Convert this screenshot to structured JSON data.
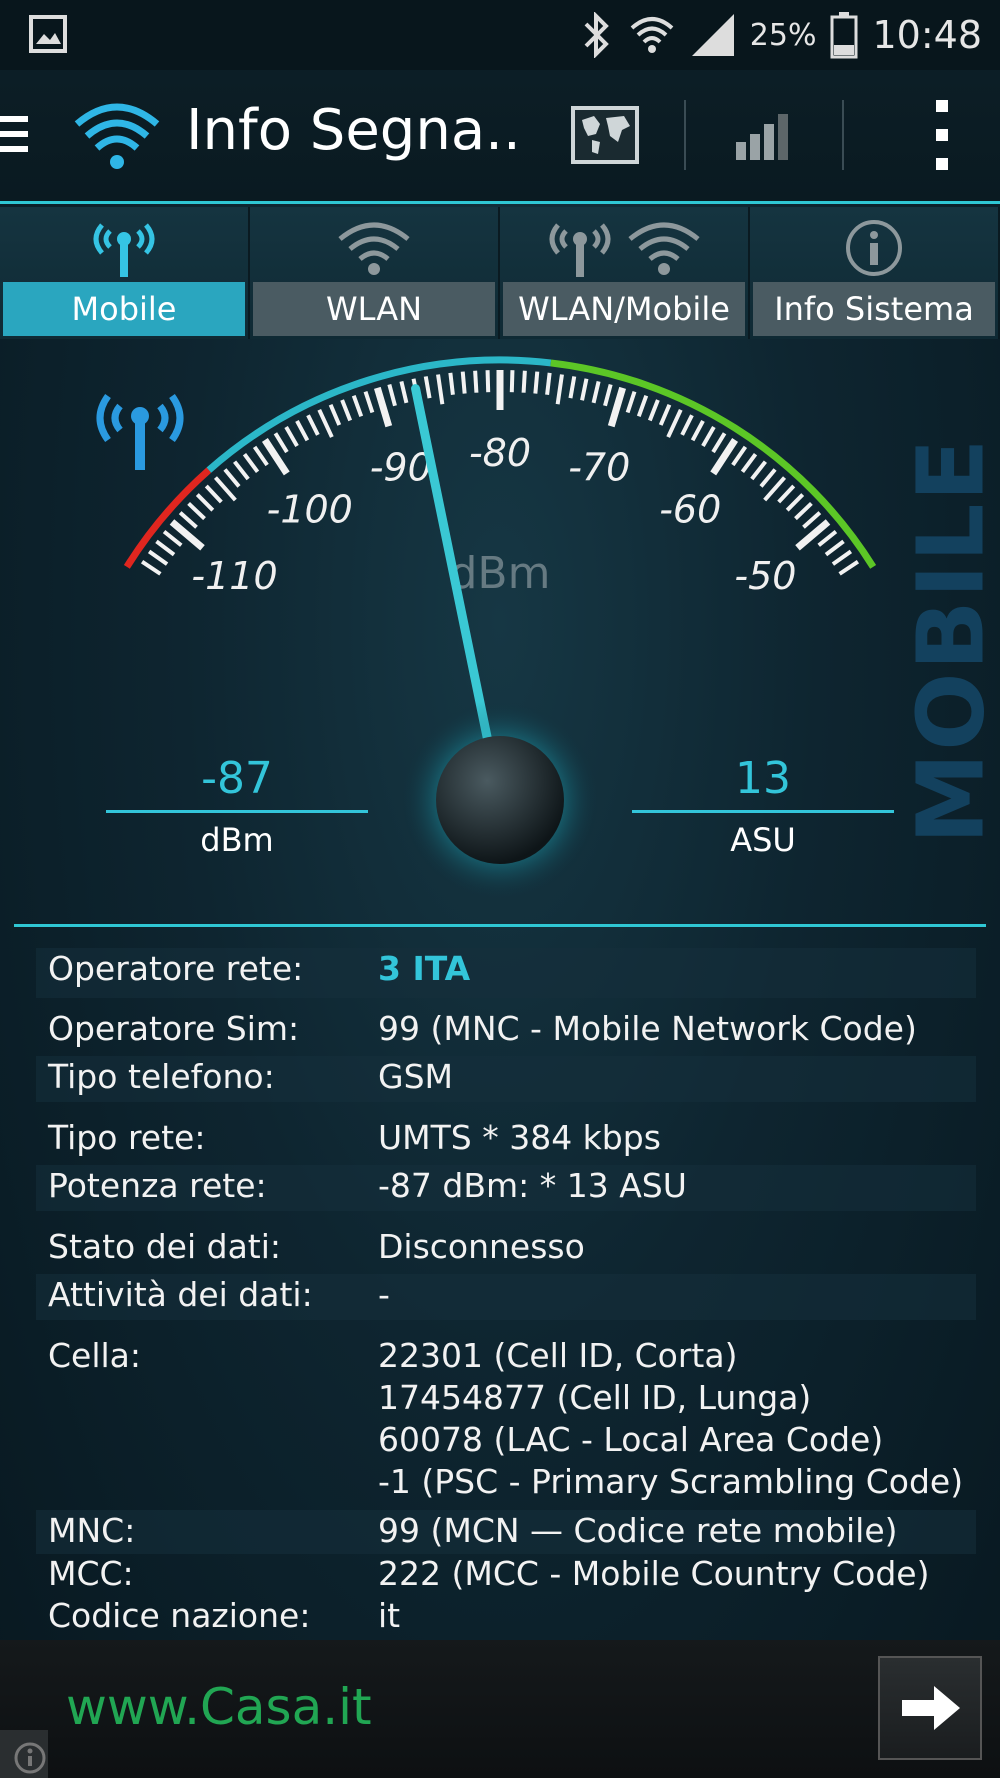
{
  "status_bar": {
    "battery_pct": "25%",
    "time": "10:48",
    "icons": [
      "gallery-icon",
      "bluetooth-icon",
      "wifi-icon",
      "signal-icon",
      "battery-icon"
    ]
  },
  "action_bar": {
    "title": "Info Segna..",
    "buttons": [
      "map-icon",
      "signal-bars-icon",
      "overflow-menu-icon"
    ]
  },
  "tabs": [
    {
      "label": "Mobile",
      "icon": "antenna-icon",
      "active": true
    },
    {
      "label": "WLAN",
      "icon": "wifi-icon",
      "active": false
    },
    {
      "label": "WLAN/Mobile",
      "icon": "antenna-wifi-icon",
      "active": false
    },
    {
      "label": "Info Sistema",
      "icon": "info-icon",
      "active": false
    }
  ],
  "gauge": {
    "unit": "dBm",
    "ticks": [
      "-110",
      "-100",
      "-90",
      "-80",
      "-70",
      "-60",
      "-50"
    ],
    "min": -115,
    "max": -45,
    "value": -87,
    "side_label": "MOBILE"
  },
  "readouts": {
    "dbm_value": "-87",
    "dbm_unit": "dBm",
    "asu_value": "13",
    "asu_unit": "ASU"
  },
  "info": {
    "operator_label": "Operatore rete:",
    "operator_value": "3 ITA",
    "sim_label": "Operatore Sim:",
    "sim_value": "99 (MNC - Mobile Network Code)",
    "phone_type_label": "Tipo telefono:",
    "phone_type_value": "GSM",
    "net_type_label": "Tipo rete:",
    "net_type_value": "UMTS * 384 kbps",
    "power_label": "Potenza rete:",
    "power_value": "-87 dBm: * 13 ASU",
    "data_state_label": "Stato dei dati:",
    "data_state_value": "Disconnesso",
    "data_activity_label": "Attività dei dati:",
    "data_activity_value": "-",
    "cell_label": "Cella:",
    "cell_values": [
      "22301 (Cell ID, Corta)",
      "17454877 (Cell ID, Lunga)",
      "60078 (LAC - Local Area Code)",
      "-1 (PSC - Primary Scrambling Code)"
    ],
    "mnc_label": "MNC:",
    "mnc_value": "99 (MCN — Codice rete mobile)",
    "mcc_label": "MCC:",
    "mcc_value": "222 (MCC - Mobile Country Code)",
    "country_label": "Codice nazione:",
    "country_value": "it"
  },
  "ad": {
    "text": "www.Casa.it"
  }
}
